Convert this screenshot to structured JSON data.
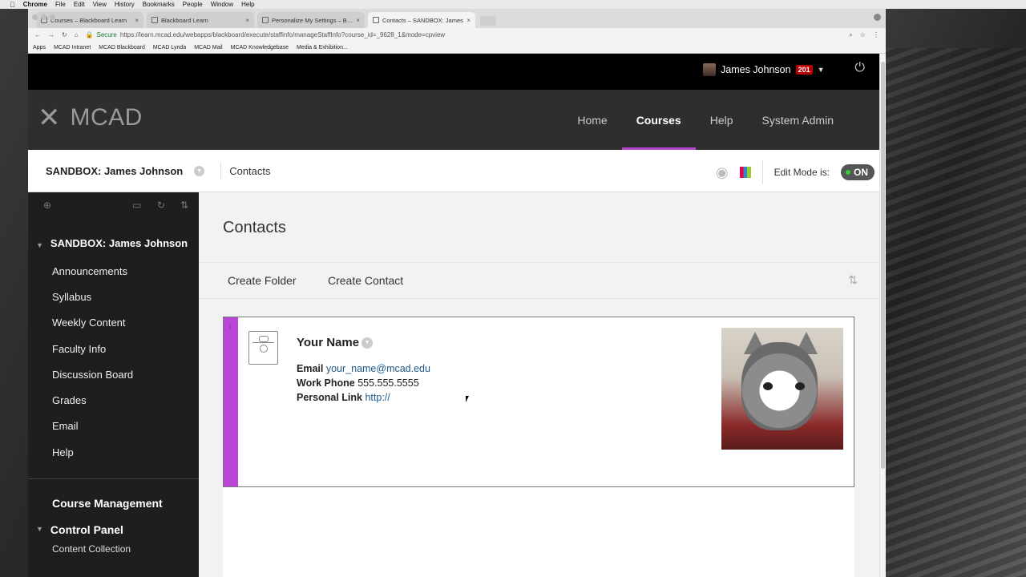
{
  "menubar": {
    "apple": "",
    "items": [
      "Chrome",
      "File",
      "Edit",
      "View",
      "History",
      "Bookmarks",
      "People",
      "Window",
      "Help"
    ]
  },
  "tabs": [
    {
      "label": "Courses – Blackboard Learn"
    },
    {
      "label": "Blackboard Learn"
    },
    {
      "label": "Personalize My Settings – Blac"
    },
    {
      "label": "Contacts – SANDBOX: James"
    }
  ],
  "address": {
    "secure": "Secure",
    "url": "https://learn.mcad.edu/webapps/blackboard/execute/staffinfo/manageStaffInfo?course_id=_9628_1&mode=cpview"
  },
  "bookmarks": [
    "Apps",
    "MCAD Intranet",
    "MCAD Blackboard",
    "MCAD Lynda",
    "MCAD Mail",
    "MCAD Knowledgebase",
    "Media & Exhibition..."
  ],
  "user": {
    "name": "James Johnson",
    "badge": "201"
  },
  "brand": {
    "name": "MCAD"
  },
  "nav": [
    {
      "label": "Home",
      "active": false
    },
    {
      "label": "Courses",
      "active": true
    },
    {
      "label": "Help",
      "active": false
    },
    {
      "label": "System Admin",
      "active": false
    }
  ],
  "crumbs": {
    "course": "SANDBOX: James Johnson",
    "page": "Contacts"
  },
  "edit_mode": {
    "label": "Edit Mode is:",
    "state": "ON"
  },
  "sidebar": {
    "course_title": "SANDBOX: James Johnson",
    "items": [
      "Announcements",
      "Syllabus",
      "Weekly Content",
      "Faculty Info",
      "Discussion Board",
      "Grades",
      "Email",
      "Help"
    ],
    "course_management": "Course Management",
    "control_panel": "Control Panel",
    "content_collection": "Content Collection"
  },
  "page": {
    "title": "Contacts",
    "actions": {
      "create_folder": "Create Folder",
      "create_contact": "Create Contact"
    }
  },
  "contact": {
    "name": "Your Name",
    "email_label": "Email",
    "email": "your_name@mcad.edu",
    "phone_label": "Work Phone",
    "phone": "555.555.5555",
    "link_label": "Personal Link",
    "link": "http://"
  },
  "colors": {
    "accent": "#b946d6",
    "alert": "#bb0000",
    "toggle_on": "#33cc33"
  },
  "icons": [
    "apple-icon",
    "secure-lock-icon",
    "mcad-x-logo-icon",
    "power-icon",
    "student-preview-eye-icon",
    "course-books-icon",
    "add-menu-item-icon",
    "folder-view-icon",
    "refresh-icon",
    "sort-icon",
    "contact-card-icon",
    "chevron-down-icon"
  ]
}
